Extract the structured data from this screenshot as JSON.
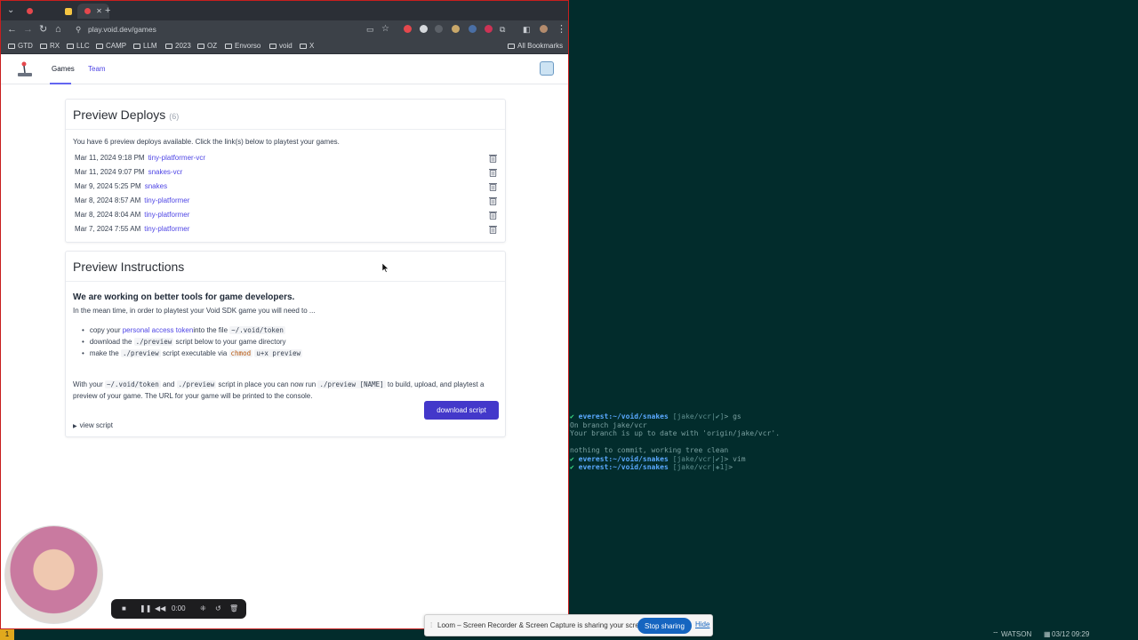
{
  "browser": {
    "new_tab": "+",
    "url": "play.void.dev/games",
    "bookmarks": [
      "GTD",
      "RX",
      "LLC",
      "CAMP",
      "LLM",
      "2023",
      "OZ",
      "Envorso",
      "void",
      "X"
    ],
    "all_bookmarks": "All Bookmarks"
  },
  "nav": {
    "tabs": [
      "Games",
      "Team"
    ]
  },
  "deploys": {
    "title": "Preview Deploys",
    "count": "(6)",
    "intro": "You have 6 preview deploys available. Click the link(s) below to playtest your games.",
    "items": [
      {
        "date": "Mar 11, 2024  9:18 PM",
        "name": "tiny-platformer-vcr"
      },
      {
        "date": "Mar 11, 2024  9:07 PM",
        "name": "snakes-vcr"
      },
      {
        "date": "Mar 9, 2024  5:25 PM",
        "name": "snakes"
      },
      {
        "date": "Mar 8, 2024  8:57 AM",
        "name": "tiny-platformer"
      },
      {
        "date": "Mar 8, 2024  8:04 AM",
        "name": "tiny-platformer"
      },
      {
        "date": "Mar 7, 2024  7:55 AM",
        "name": "tiny-platformer"
      }
    ]
  },
  "instructions": {
    "title": "Preview Instructions",
    "heading": "We are working on better tools for game developers.",
    "lead": "In the mean time, in order to playtest your Void SDK game you will need to ...",
    "step1_a": "copy your ",
    "step1_link": "personal access token",
    "step1_b": "into the file ",
    "step1_code": "~/.void/token",
    "step2_a": "download the ",
    "step2_code": "./preview",
    "step2_b": " script below to your game directory",
    "step3_a": "make the ",
    "step3_code1": "./preview",
    "step3_b": " script executable via ",
    "step3_code2": "chmod",
    "step3_code3": "u+x preview",
    "with_a": "With your ",
    "with_code1": "~/.void/token",
    "with_b": " and ",
    "with_code2": "./preview",
    "with_c": " script in place you can now run ",
    "with_code3": "./preview [NAME]",
    "with_d": " to build, upload, and playtest a preview of your game. The URL for your game will be printed to the console.",
    "download_label": "download script",
    "view_script": "view script"
  },
  "terminal": {
    "lines": [
      {
        "host": "everest:~/void/snakes",
        "branch": "[jake/vcr|✔]",
        "cmd": "gs"
      },
      {
        "text": "On branch jake/vcr"
      },
      {
        "text": "Your branch is up to date with 'origin/jake/vcr'."
      },
      {
        "text": ""
      },
      {
        "text": "nothing to commit, working tree clean"
      },
      {
        "host": "everest:~/void/snakes",
        "branch": "[jake/vcr|✔]",
        "cmd": "vim"
      },
      {
        "host": "everest:~/void/snakes",
        "branch": "[jake/vcr|✚1]",
        "cmd": ""
      }
    ]
  },
  "status": {
    "workspace": "1",
    "host": "WATSON",
    "datetime": "03/12 09:29"
  },
  "loom": {
    "timer": "0:00",
    "share_text": "Loom – Screen Recorder & Screen Capture is sharing your screen.",
    "stop_label": "Stop sharing",
    "hide_label": "Hide"
  },
  "colors": {
    "accent": "#4338ca",
    "link": "#4f46e5",
    "terminal_bg": "#022c2c",
    "frame": "#c81e1e"
  }
}
